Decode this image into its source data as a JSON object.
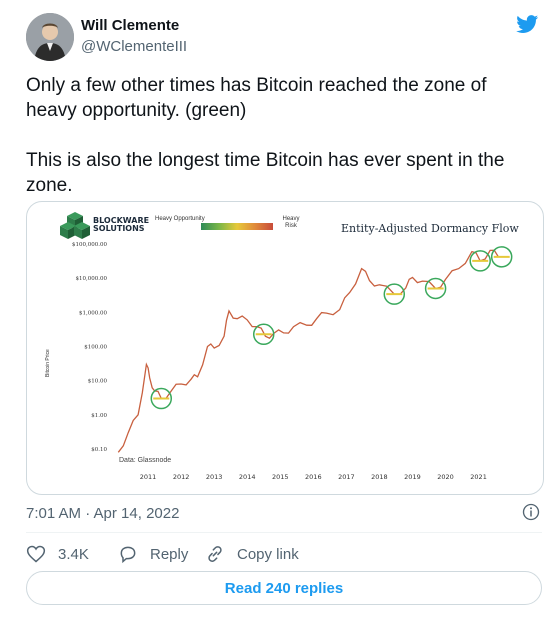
{
  "author": {
    "name": "Will Clemente",
    "handle": "@WClementeIII"
  },
  "tweet": {
    "text": "Only a few other times has Bitcoin reached the zone of heavy opportunity. (green)\n\nThis is also the longest time Bitcoin has ever spent in the zone.",
    "timestamp": "7:01 AM · Apr 14, 2022"
  },
  "media": {
    "logo_line1": "BLOCKWARE",
    "logo_line2": "SOLUTIONS",
    "legend_left": "Heavy Opportunity",
    "legend_right": "Heavy Risk",
    "data_source": "Data: Glassnode",
    "y_axis_label": "Bitcoin Price",
    "colors": {
      "opportunity": "#2e8b57",
      "risk": "#c84b3a",
      "circle": "#3aa85c"
    }
  },
  "chart_data": {
    "type": "line",
    "title": "Entity-Adjusted Dormancy Flow",
    "ylabel": "Bitcoin Price",
    "xlabel": "",
    "y_scale": "log",
    "y_ticks": [
      "$100,000.00",
      "$10,000.00",
      "$1,000.00",
      "$100.00",
      "$10.00",
      "$1.00",
      "$0.10"
    ],
    "x_ticks": [
      "2011",
      "2012",
      "2013",
      "2014",
      "2015",
      "2016",
      "2017",
      "2018",
      "2019",
      "2020",
      "2021"
    ],
    "ylim": [
      0.1,
      100000
    ],
    "series": [
      {
        "x": [
          2010.6,
          2010.9,
          2011.2,
          2011.45,
          2011.55,
          2011.7,
          2011.9,
          2012.2,
          2012.5,
          2012.8,
          2013.0,
          2013.3,
          2013.5,
          2013.8,
          2013.95,
          2014.2,
          2014.5,
          2014.8,
          2015.05,
          2015.3,
          2015.6,
          2015.9,
          2016.3,
          2016.6,
          2016.9,
          2017.3,
          2017.6,
          2017.96,
          2018.2,
          2018.5,
          2018.95,
          2019.3,
          2019.5,
          2019.8,
          2020.2,
          2020.5,
          2020.9,
          2021.3,
          2021.55,
          2021.85,
          2022.1
        ],
        "y": [
          0.08,
          0.3,
          1.0,
          30,
          12,
          5,
          3,
          5,
          8,
          11,
          13,
          100,
          90,
          200,
          1100,
          650,
          600,
          380,
          200,
          240,
          250,
          380,
          420,
          650,
          950,
          1200,
          3800,
          19000,
          8500,
          6400,
          3400,
          5200,
          10500,
          8200,
          5000,
          9200,
          19000,
          60000,
          32000,
          65000,
          42000
        ]
      }
    ],
    "opportunity_highlights": [
      2011.9,
      2015.0,
      2018.95,
      2020.2,
      2021.55,
      2022.2
    ]
  },
  "actions": {
    "likes": "3.4K",
    "reply_label": "Reply",
    "copy_label": "Copy link",
    "read_replies": "Read 240 replies"
  }
}
